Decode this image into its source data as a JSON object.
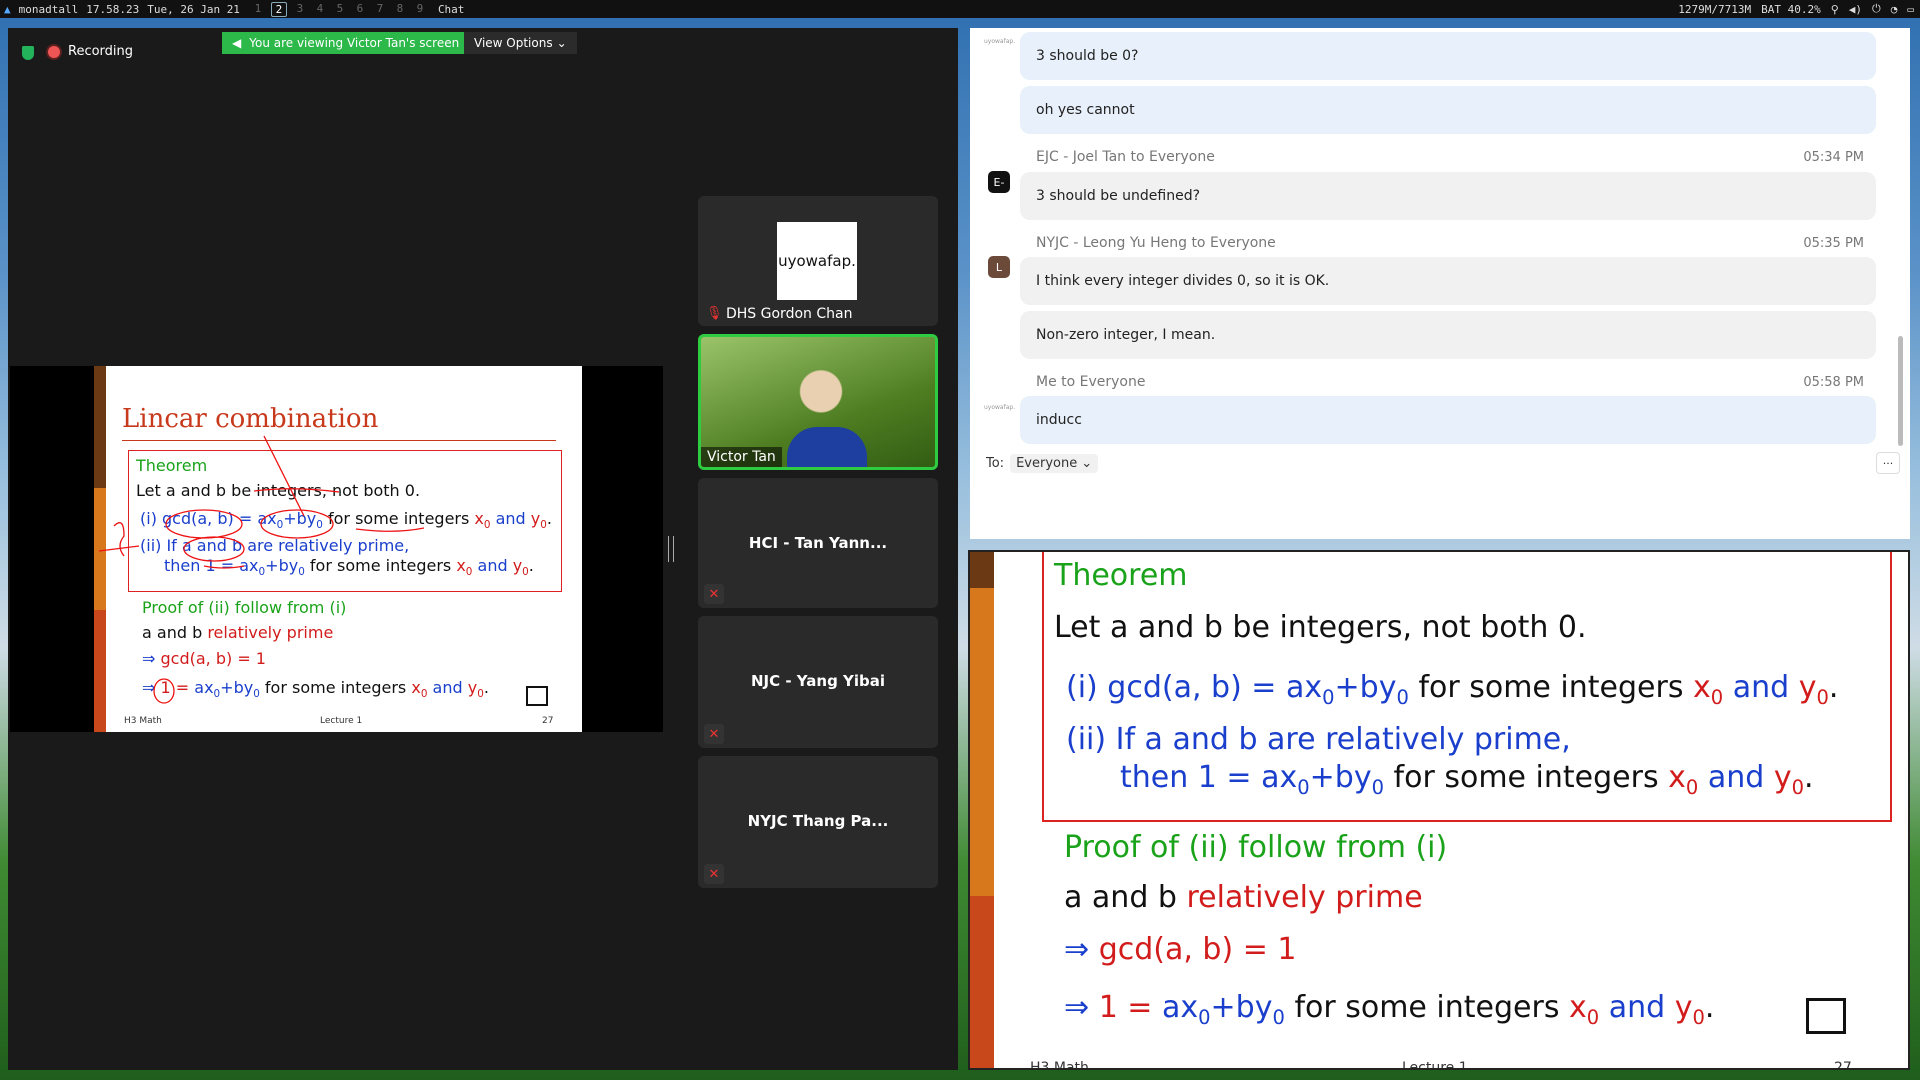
{
  "topbar": {
    "user": "monadtall",
    "time": "17.58.23",
    "date": "Tue, 26 Jan 21",
    "workspaces": [
      "1",
      "2",
      "3",
      "4",
      "5",
      "6",
      "7",
      "8",
      "9"
    ],
    "active_workspace": "2",
    "window_title": "Chat",
    "memory": "1279M/7713M",
    "battery": "BAT 40.2%"
  },
  "meeting": {
    "recording_label": "Recording",
    "viewing_banner": "You are viewing Victor Tan's screen",
    "view_options": "View Options"
  },
  "participants": [
    {
      "name": "DHS Gordon Chan",
      "avatar_text": "uyowafap.",
      "muted": true
    },
    {
      "name": "Victor Tan",
      "muted": false,
      "active_speaker": true
    },
    {
      "name": "HCI - Tan Yann...",
      "muted": true
    },
    {
      "name": "NJC - Yang Yibai",
      "muted": true
    },
    {
      "name": "NYJC Thang Pa...",
      "muted": true
    }
  ],
  "chat": {
    "messages": [
      {
        "text": "3 should be 0?"
      },
      {
        "text": "oh yes cannot"
      },
      {
        "sender": "EJC - Joel Tan to Everyone",
        "time": "05:34 PM",
        "avatar": "E-",
        "text": "3 should be undefined?"
      },
      {
        "sender": "NYJC - Leong Yu Heng to Everyone",
        "time": "05:35 PM",
        "avatar": "L",
        "text": "I think every integer divides 0, so it is OK."
      },
      {
        "text": "Non-zero integer, I mean."
      },
      {
        "sender": "Me to Everyone",
        "time": "05:58 PM",
        "text": "inducc"
      }
    ],
    "tiny_avatar_label": "uyowafap.",
    "to_label": "To:",
    "recipient": "Everyone",
    "more": "···"
  },
  "slide": {
    "title": "Lincar combination",
    "theorem_label": "Theorem",
    "statement": "Let a and b be integers, not both 0.",
    "part_i_prefix": "(i) gcd(a, b) = ",
    "ax": "ax",
    "by": "+by",
    "sub0": "0",
    "for_some": " for some integers ",
    "x": "x",
    "and": " and ",
    "y": "y",
    "dot": ".",
    "part_ii_a": "(ii) If a and b are relatively prime,",
    "part_ii_b": "then 1 = ",
    "proof_label": "Proof of (ii) follow from (i)",
    "ab": "a and b ",
    "rel_prime": "relatively prime",
    "implies": "⇒ ",
    "gcd_eq": "gcd(a, b) = 1",
    "one_eq": "1 = ",
    "footer_left": "H3 Math",
    "footer_mid": "Lecture 1",
    "footer_right": "27"
  },
  "colors": {
    "green": "#1aa31a",
    "blue": "#1a3fcc",
    "red": "#d21c1c",
    "title_red": "#c8391c"
  }
}
